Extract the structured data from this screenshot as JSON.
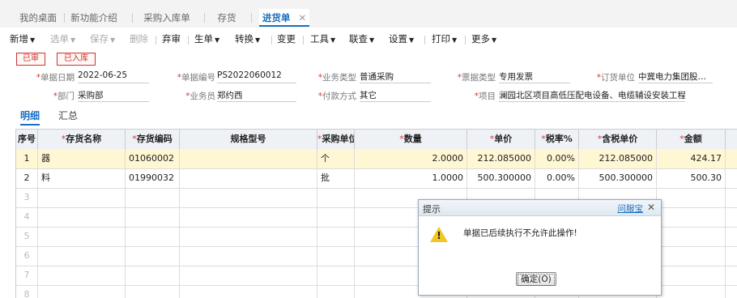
{
  "tabs": [
    {
      "label": "我的桌面"
    },
    {
      "label": "新功能介绍"
    },
    {
      "label": "采购入库单"
    },
    {
      "label": "存货"
    },
    {
      "label": "进货单",
      "close": "✕"
    }
  ],
  "toolbar": {
    "items": [
      "新增",
      "选单",
      "保存",
      "删除",
      "弃审",
      "生单",
      "转换",
      "变更",
      "工具",
      "联查",
      "设置",
      "打印",
      "更多"
    ]
  },
  "stamps": {
    "audited": "已审",
    "stocked": "已入库"
  },
  "form": {
    "required_mark": "*",
    "date_label": "单据日期",
    "date_value": "2022-06-25",
    "no_label": "单据编号",
    "no_value": "PS2022060012",
    "biz_label": "业务类型",
    "biz_value": "普通采购",
    "invoice_label": "票据类型",
    "invoice_value": "专用发票",
    "supplier_label": "订货单位",
    "supplier_value": "中冀电力集团股…",
    "dept_label": "部门",
    "dept_value": "采购部",
    "staff_label": "业务员",
    "staff_value": "郑约西",
    "pay_label": "付款方式",
    "pay_value": "其它",
    "project_label": "项目",
    "project_value": "澜园北区项目高低压配电设备、电缆辅设安装工程"
  },
  "subtabs": {
    "detail": "明细",
    "summary": "汇总"
  },
  "grid": {
    "headers": {
      "idx": "序号",
      "name": "存货名称",
      "code": "存货编码",
      "spec": "规格型号",
      "unit": "采购单位",
      "qty": "数量",
      "price": "单价",
      "tax": "税率%",
      "taxprice": "含税单价",
      "amount": "金额"
    },
    "rows": [
      {
        "idx": "1",
        "name": "器",
        "code": "01060002",
        "spec": "",
        "unit": "个",
        "qty": "2.0000",
        "price": "212.085000",
        "tax": "0.00%",
        "taxprice": "212.085000",
        "amount": "424.17"
      },
      {
        "idx": "2",
        "name": "料",
        "code": "01990032",
        "spec": "",
        "unit": "批",
        "qty": "1.0000",
        "price": "500.300000",
        "tax": "0.00%",
        "taxprice": "500.300000",
        "amount": "500.30"
      }
    ],
    "empty_rows": [
      "3",
      "4",
      "5",
      "6",
      "7",
      "8"
    ]
  },
  "dialog": {
    "title": "提示",
    "help": "问服宝",
    "close": "✕",
    "warn_mark": "!",
    "message": "单据已后续执行不允许此操作!",
    "ok": "确定(O)"
  }
}
